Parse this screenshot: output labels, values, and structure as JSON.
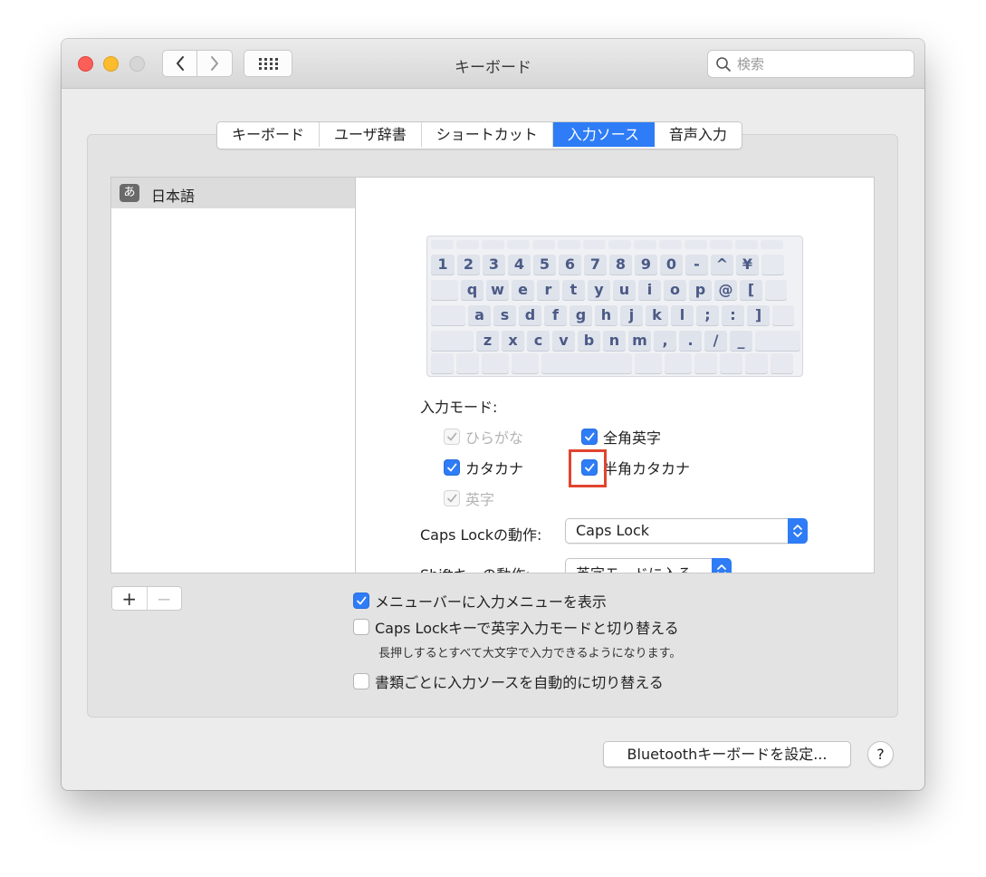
{
  "window": {
    "title": "キーボード"
  },
  "search": {
    "placeholder": "検索"
  },
  "tabs": [
    {
      "label": "キーボード",
      "active": false
    },
    {
      "label": "ユーザ辞書",
      "active": false
    },
    {
      "label": "ショートカット",
      "active": false
    },
    {
      "label": "入力ソース",
      "active": true
    },
    {
      "label": "音声入力",
      "active": false
    }
  ],
  "sources": [
    {
      "badge": "あ",
      "label": "日本語",
      "selected": true
    }
  ],
  "keyboard": {
    "row1": [
      "1",
      "2",
      "3",
      "4",
      "5",
      "6",
      "7",
      "8",
      "9",
      "0",
      "-",
      "^",
      "¥"
    ],
    "row2": [
      "q",
      "w",
      "e",
      "r",
      "t",
      "y",
      "u",
      "i",
      "o",
      "p",
      "@",
      "["
    ],
    "row3": [
      "a",
      "s",
      "d",
      "f",
      "g",
      "h",
      "j",
      "k",
      "l",
      ";",
      ":",
      "]"
    ],
    "row4": [
      "z",
      "x",
      "c",
      "v",
      "b",
      "n",
      "m",
      ",",
      ".",
      "/",
      "_"
    ]
  },
  "input_modes": {
    "label": "入力モード:",
    "hiragana": {
      "label": "ひらがな",
      "checked": true,
      "disabled": true
    },
    "zenkaku_eiji": {
      "label": "全角英字",
      "checked": true
    },
    "katakana": {
      "label": "カタカナ",
      "checked": true
    },
    "hankaku_katakana": {
      "label": "半角カタカナ",
      "checked": true
    },
    "eiji": {
      "label": "英字",
      "checked": true,
      "disabled": true
    }
  },
  "caps_lock_action": {
    "label": "Caps Lockの動作:",
    "value": "Caps Lock"
  },
  "shift_action": {
    "label": "Shiftキーの動作:",
    "value": "英字モードに入る"
  },
  "list_buttons": {
    "add": "+",
    "remove": "−"
  },
  "options": {
    "show_menu": {
      "label": "メニューバーに入力メニューを表示",
      "checked": true
    },
    "caps_switch": {
      "label": "Caps Lockキーで英字入力モードと切り替える",
      "checked": false
    },
    "caps_hint": "長押しするとすべて大文字で入力できるようになります。",
    "auto_switch": {
      "label": "書類ごとに入力ソースを自動的に切り替える",
      "checked": false
    }
  },
  "bluetooth_button": "Bluetoothキーボードを設定...",
  "help_button": "?",
  "colors": {
    "accent": "#2e7cf6",
    "highlight": "#e0442f"
  }
}
